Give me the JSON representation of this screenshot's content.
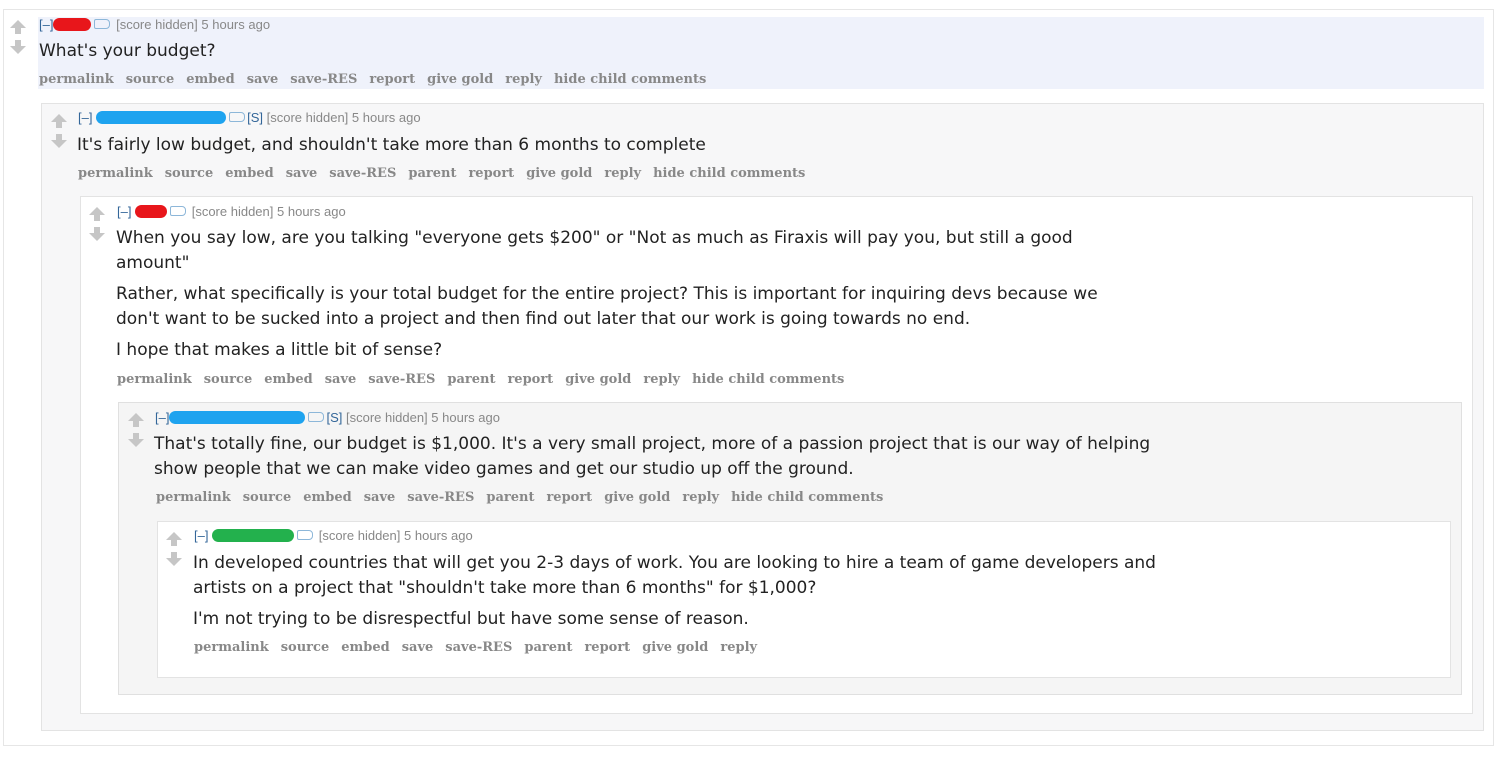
{
  "colors": {
    "redact_red": "#e8161b",
    "redact_blue": "#1ea3ef",
    "redact_green": "#23b14d",
    "link_blue": "#336699"
  },
  "comments": [
    {
      "expand": "[–]",
      "score": "[score hidden]",
      "time": "5 hours ago",
      "body": [
        "What's your budget?"
      ],
      "buttons": [
        "permalink",
        "source",
        "embed",
        "save",
        "save-RES",
        "report",
        "give gold",
        "reply",
        "hide child comments"
      ]
    },
    {
      "expand": "[–]",
      "submitter": "[S]",
      "score": "[score hidden]",
      "time": "5 hours ago",
      "body": [
        "It's fairly low budget, and shouldn't take more than 6 months to complete"
      ],
      "buttons": [
        "permalink",
        "source",
        "embed",
        "save",
        "save-RES",
        "parent",
        "report",
        "give gold",
        "reply",
        "hide child comments"
      ]
    },
    {
      "expand": "[–]",
      "score": "[score hidden]",
      "time": "5 hours ago",
      "body": [
        "When you say low, are you talking \"everyone gets $200\" or \"Not as much as Firaxis will pay you, but still a good",
        "amount\"",
        "Rather, what specifically is your total budget for the entire project? This is important for inquiring devs because we",
        "don't want to be sucked into a project and then find out later that our work is going towards no end.",
        "I hope that makes a little bit of sense?"
      ],
      "buttons": [
        "permalink",
        "source",
        "embed",
        "save",
        "save-RES",
        "parent",
        "report",
        "give gold",
        "reply",
        "hide child comments"
      ]
    },
    {
      "expand": "[–]",
      "submitter": "[S]",
      "score": "[score hidden]",
      "time": "5 hours ago",
      "body": [
        "That's totally fine, our budget is $1,000. It's a very small project, more of a passion project that is our way of helping",
        "show people that we can make video games and get our studio up off the ground."
      ],
      "buttons": [
        "permalink",
        "source",
        "embed",
        "save",
        "save-RES",
        "parent",
        "report",
        "give gold",
        "reply",
        "hide child comments"
      ]
    },
    {
      "expand": "[–]",
      "score": "[score hidden]",
      "time": "5 hours ago",
      "body": [
        "In developed countries that will get you 2-3 days of work. You are looking to hire a team of game developers and",
        "artists on a project that \"shouldn't take more than 6 months\" for $1,000?",
        "I'm not trying to be disrespectful but have some sense of reason."
      ],
      "buttons": [
        "permalink",
        "source",
        "embed",
        "save",
        "save-RES",
        "parent",
        "report",
        "give gold",
        "reply"
      ]
    }
  ]
}
